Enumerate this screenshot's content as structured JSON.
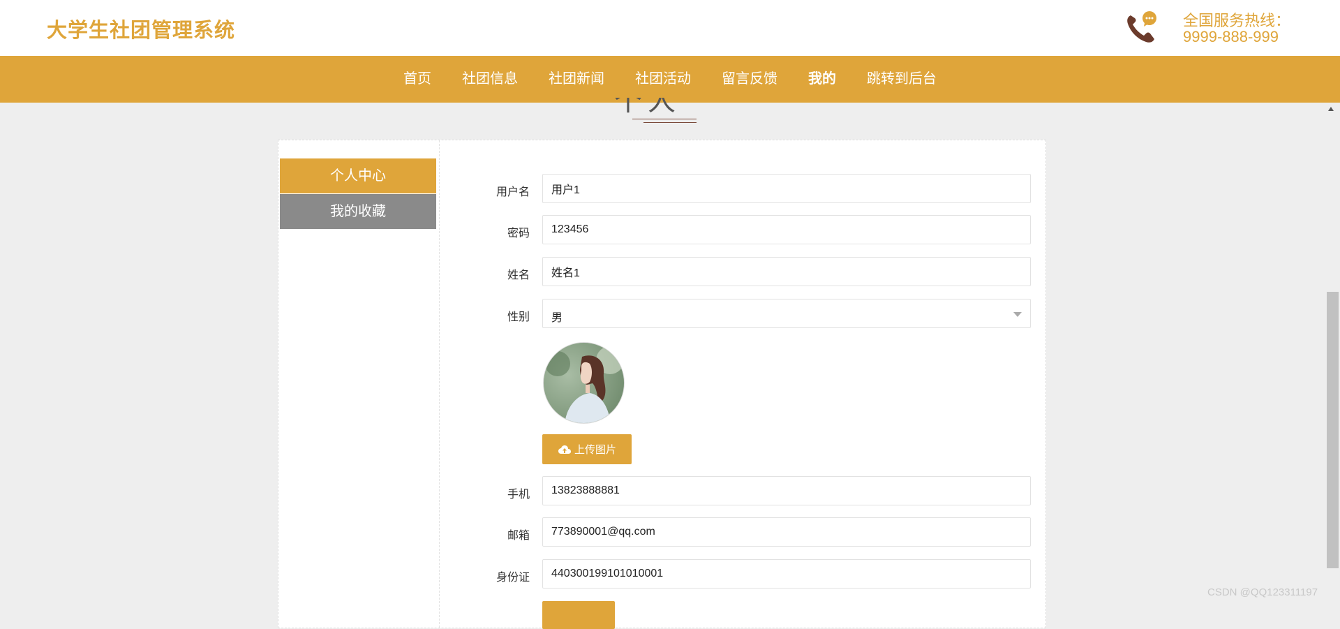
{
  "header": {
    "brand": "大学生社团管理系统",
    "hotline_label": "全国服务热线：",
    "hotline_number": "9999-888-999"
  },
  "nav": {
    "items": [
      {
        "label": "首页"
      },
      {
        "label": "社团信息"
      },
      {
        "label": "社团新闻"
      },
      {
        "label": "社团活动"
      },
      {
        "label": "留言反馈"
      },
      {
        "label": "我的"
      },
      {
        "label": "跳转到后台"
      }
    ],
    "active": "我的"
  },
  "section": {
    "title": "个人中心"
  },
  "sidebar": {
    "items": [
      {
        "label": "个人中心"
      },
      {
        "label": "我的收藏"
      }
    ]
  },
  "form": {
    "username_label": "用户名",
    "username_value": "用户1",
    "password_label": "密码",
    "password_value": "123456",
    "name_label": "姓名",
    "name_value": "姓名1",
    "gender_label": "性别",
    "gender_value": "男",
    "upload_label": "上传图片",
    "phone_label": "手机",
    "phone_value": "13823888881",
    "email_label": "邮箱",
    "email_value": "773890001@qq.com",
    "idcard_label": "身份证",
    "idcard_value": "440300199101010001"
  },
  "watermark": "CSDN @QQ123311197",
  "colors": {
    "accent": "#dfa53a",
    "sidebar_inactive": "#8a8a8a",
    "background": "#eeeeee"
  },
  "icons": [
    "phone-chat-icon",
    "upload-cloud-icon",
    "chevron-down-icon",
    "scroll-up-arrow-icon"
  ]
}
